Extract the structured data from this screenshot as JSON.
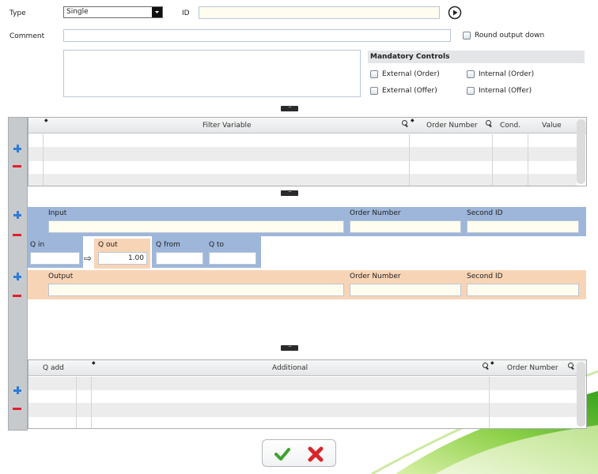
{
  "header": {
    "type_label": "Type",
    "type_value": "Single",
    "id_label": "ID",
    "id_value": "",
    "comment_label": "Comment",
    "comment_value": "",
    "round_output_label": "Round output down"
  },
  "mandatory": {
    "title": "Mandatory Controls",
    "external_order": "External (Order)",
    "internal_order": "Internal (Order)",
    "external_offer": "External (Offer)",
    "internal_offer": "Internal (Offer)"
  },
  "splitter_glyph": "····",
  "filter_grid": {
    "columns": [
      "Filter Variable",
      "Order Number",
      "Cond.",
      "Value"
    ]
  },
  "input_section": {
    "input_label": "Input",
    "order_number_label": "Order Number",
    "second_id_label": "Second ID"
  },
  "quantity": {
    "q_in_label": "Q in",
    "q_out_label": "Q out",
    "q_out_value": "1.00",
    "q_from_label": "Q from",
    "q_to_label": "Q to",
    "arrow": "⇨"
  },
  "output_section": {
    "output_label": "Output",
    "order_number_label": "Order Number",
    "second_id_label": "Second ID"
  },
  "additional_grid": {
    "columns": [
      "Q add",
      "Additional",
      "Order Number"
    ]
  },
  "colors": {
    "input_band": "#9db6da",
    "output_band": "#f8d4b6",
    "field_bg": "#fffdf0",
    "accent_plus": "#2f7cd6",
    "accent_minus": "#e0202a"
  }
}
